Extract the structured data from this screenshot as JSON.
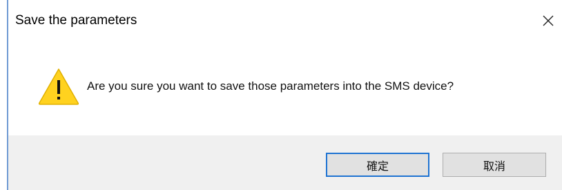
{
  "window": {
    "title": "Save the parameters",
    "close_icon": "close-icon"
  },
  "message": {
    "icon": "warning-icon",
    "text": "Are you sure you want to save those parameters into the SMS device?"
  },
  "buttons": {
    "confirm_label": "確定",
    "cancel_label": "取消"
  },
  "colors": {
    "warning_fill": "#FFD21F",
    "accent": "#1E73D2"
  }
}
